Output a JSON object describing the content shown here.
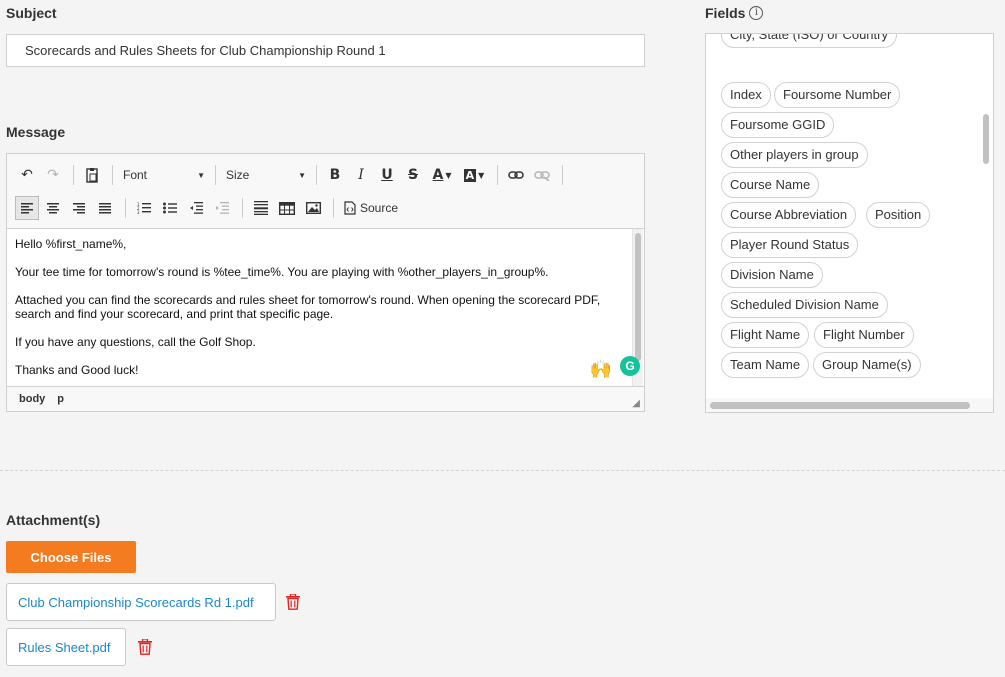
{
  "subject": {
    "label": "Subject",
    "value": "Scorecards and Rules Sheets for Club Championship Round 1"
  },
  "message": {
    "label": "Message",
    "toolbar": {
      "font_label": "Font",
      "size_label": "Size",
      "source_label": "Source"
    },
    "lines": [
      "Hello %first_name%,",
      "Your tee time for tomorrow's round is %tee_time%. You are playing with %other_players_in_group%.",
      "Attached you can find the scorecards and rules sheet for tomorrow's round. When opening the scorecard PDF, search and find your scorecard, and print that specific page.",
      "If you have any questions, call the Golf Shop.",
      "Thanks and Good luck!"
    ],
    "status_path": [
      "body",
      "p"
    ]
  },
  "fields": {
    "label": "Fields",
    "items": [
      "City, State (ISO) or Country",
      "Index",
      "Foursome Number",
      "Foursome GGID",
      "Other players in group",
      "Course Name",
      "Course Abbreviation",
      "Position",
      "Player Round Status",
      "Division Name",
      "Scheduled Division Name",
      "Flight Name",
      "Flight Number",
      "Team Name",
      "Group Name(s)"
    ]
  },
  "attachments": {
    "label": "Attachment(s)",
    "choose_label": "Choose Files",
    "files": [
      "Club Championship Scorecards Rd 1.pdf",
      "Rules Sheet.pdf"
    ]
  },
  "colors": {
    "accent": "#f47b20",
    "link": "#1c88c4",
    "danger": "#e02424"
  }
}
